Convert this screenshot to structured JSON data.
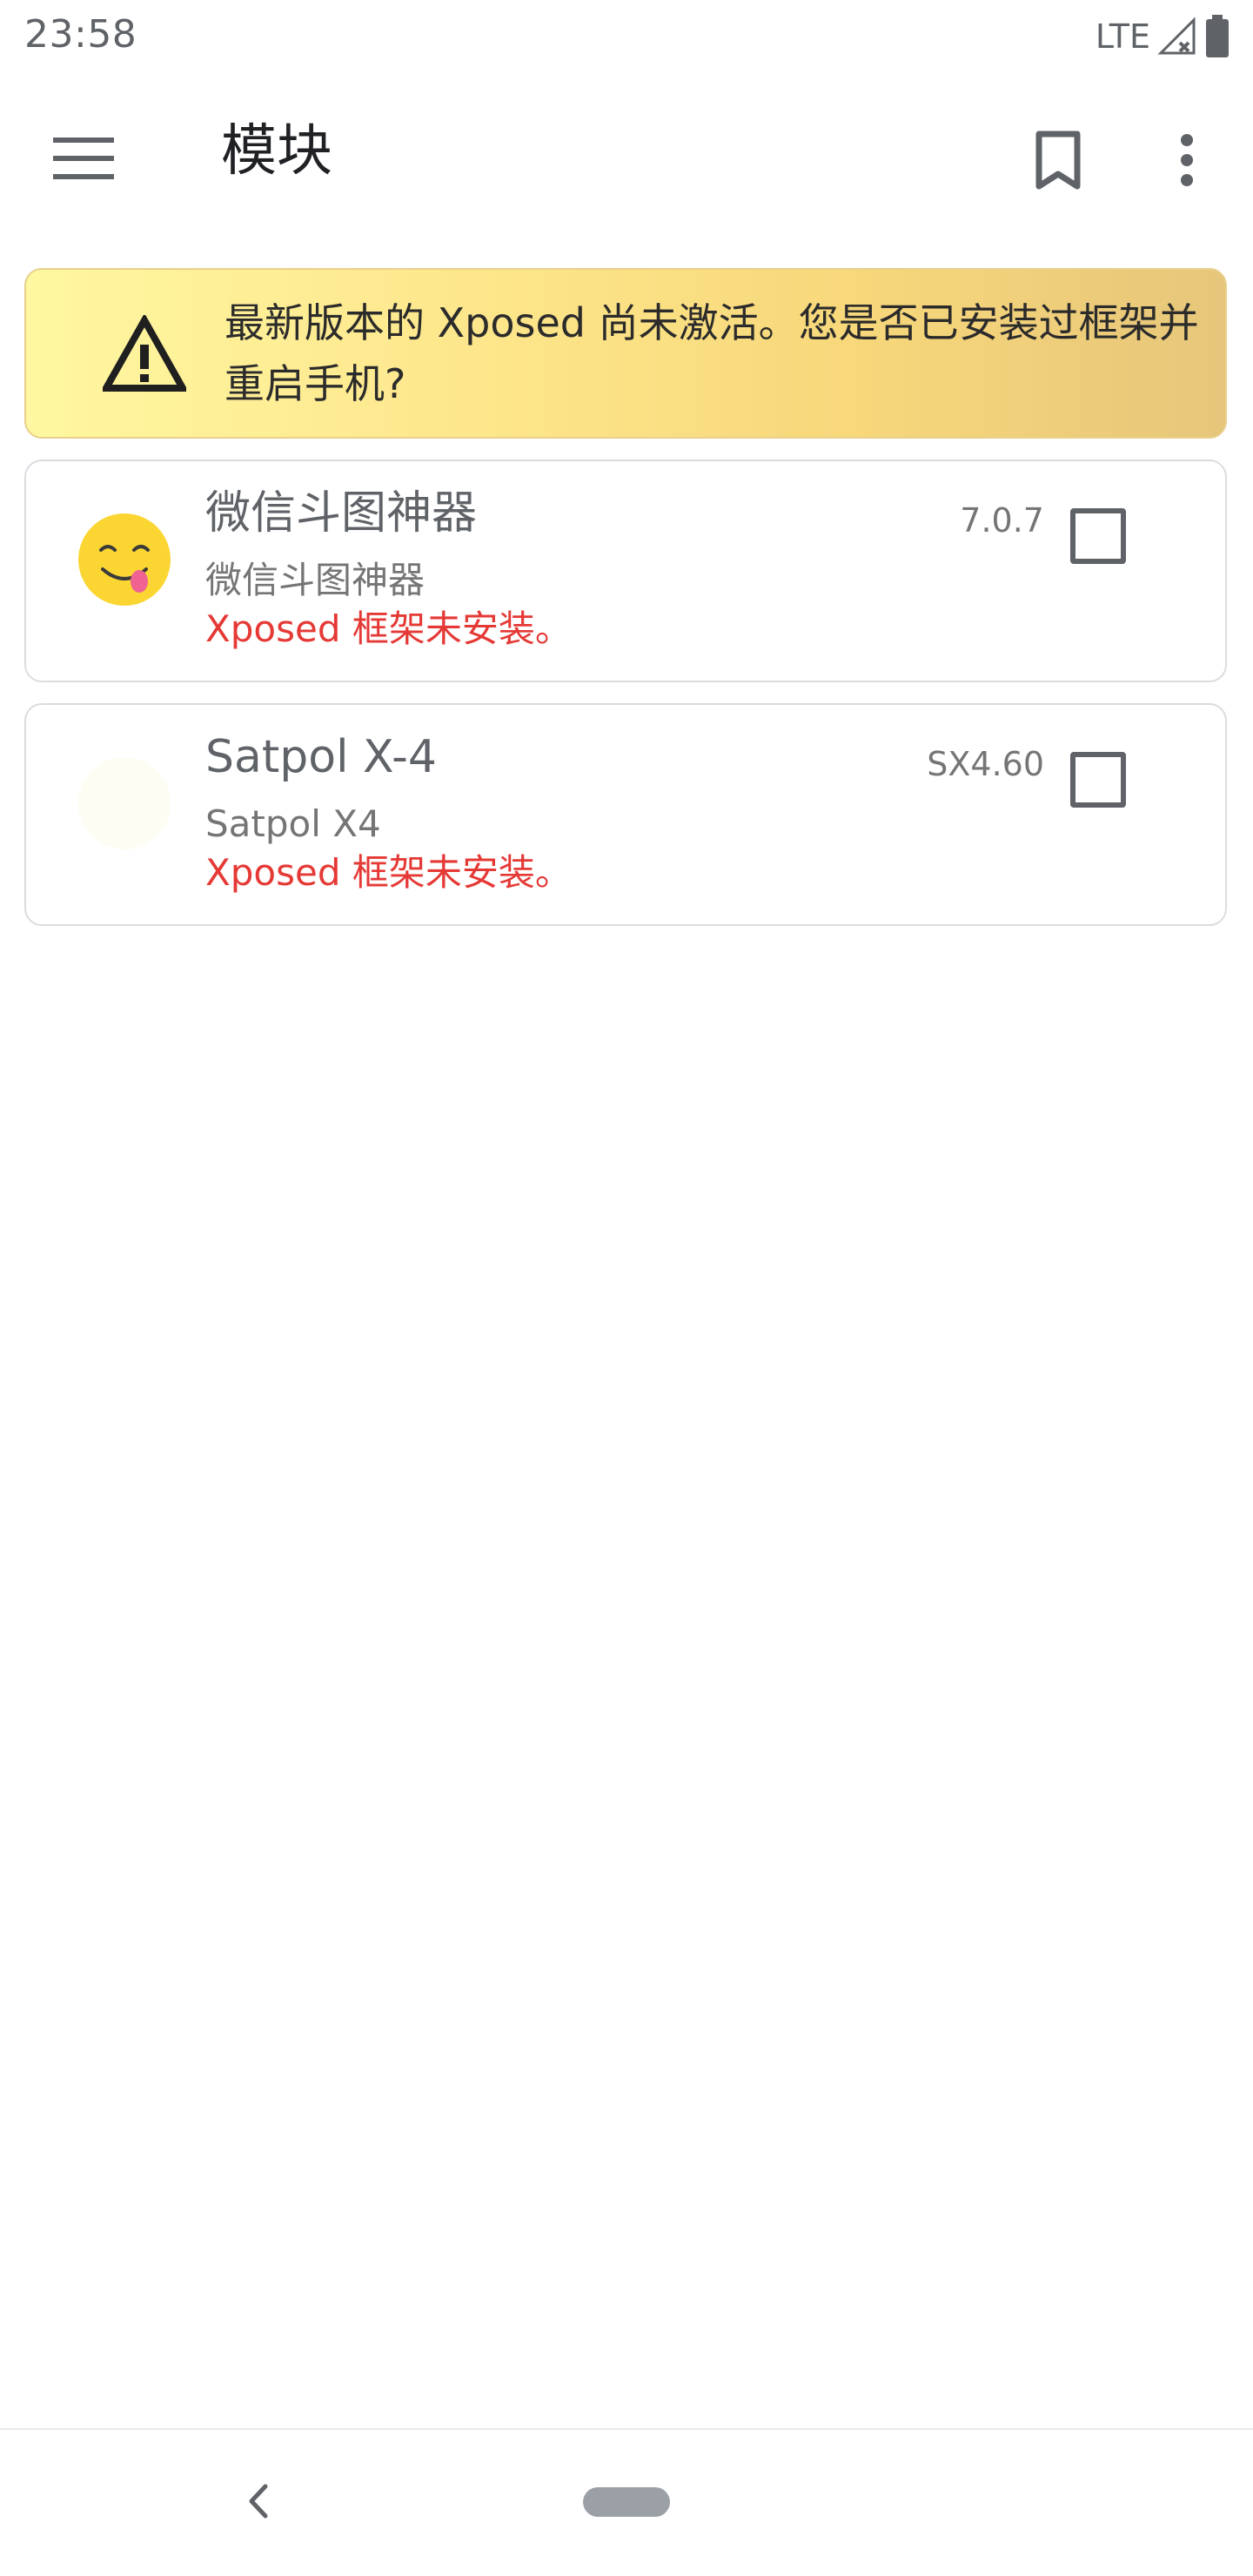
{
  "status_bar": {
    "time": "23:58",
    "network": "LTE",
    "icons": [
      "signal-no-service-icon",
      "battery-icon"
    ]
  },
  "toolbar": {
    "title": "模块",
    "icons": [
      "menu-icon",
      "bookmark-icon",
      "overflow-menu-icon"
    ]
  },
  "warning": {
    "text": "最新版本的 Xposed 尚未激活。您是否已安装过框架并重启手机?",
    "icon": "warning-icon"
  },
  "modules": [
    {
      "name": "微信斗图神器",
      "description": "微信斗图神器",
      "status": "Xposed 框架未安装。",
      "version": "7.0.7",
      "enabled": false,
      "icon": "emoji-tongue-icon"
    },
    {
      "name": "Satpol X-4",
      "description": "Satpol X4",
      "status": "Xposed 框架未安装。",
      "version": "SX4.60",
      "enabled": false,
      "icon": "app-icon"
    }
  ],
  "nav_bar": {
    "icons": [
      "back-icon",
      "home-pill-icon"
    ]
  },
  "colors": {
    "error_text": "#e53935",
    "warning_banner_start": "#fff7a1",
    "warning_banner_end": "#e6c67a",
    "card_border": "#dadce0"
  }
}
